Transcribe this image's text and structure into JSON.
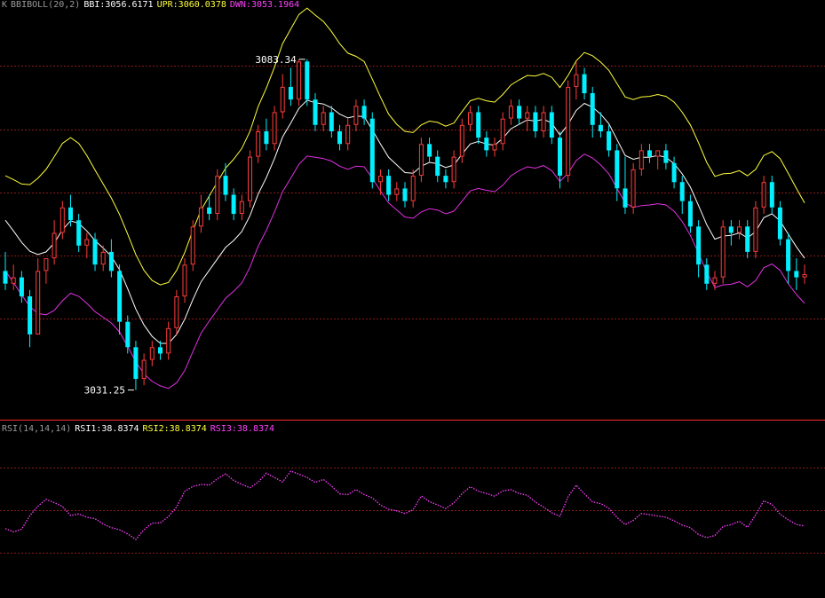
{
  "header": {
    "main": {
      "k_label": "K",
      "indicator": "BBIBOLL(20,2)",
      "bbi": "BBI:3056.6171",
      "upr": "UPR:3060.0378",
      "dwn": "DWN:3053.1964"
    },
    "rsi": {
      "indicator": "RSI(14,14,14)",
      "rsi1": "RSI1:38.8374",
      "rsi2": "RSI2:38.8374",
      "rsi3": "RSI3:38.8374"
    }
  },
  "colors": {
    "background": "#000000",
    "grid": "#8a1a1a",
    "up": "#ff3c3c",
    "down": "#00f0ff",
    "bbi": "#ffffff",
    "upr": "#ffff3a",
    "dwn": "#e030e0",
    "rsi": "#ff40ff",
    "separator": "#ff2a2a"
  },
  "chart_data": [
    {
      "type": "candlestick",
      "name": "main",
      "ylim": [
        3027.0,
        3091.0
      ],
      "gridlines": [
        3082.3,
        3072.3,
        3062.4,
        3052.5,
        3042.5
      ],
      "annotations": [
        {
          "label": "3083.34",
          "index": 37,
          "value": 3083.34,
          "side": "left"
        },
        {
          "label": "3031.25",
          "index": 16,
          "value": 3031.25,
          "side": "left"
        }
      ],
      "ohlc": [
        [
          3050.0,
          3053.0,
          3047.0,
          3048.0
        ],
        [
          3048.0,
          3051.0,
          3047.0,
          3049.0
        ],
        [
          3049.0,
          3050.0,
          3045.0,
          3046.0
        ],
        [
          3046.0,
          3047.0,
          3038.0,
          3040.0
        ],
        [
          3040.0,
          3052.0,
          3040.0,
          3050.0
        ],
        [
          3050.0,
          3052.0,
          3048.0,
          3052.0
        ],
        [
          3052.0,
          3058.0,
          3051.0,
          3056.0
        ],
        [
          3056.0,
          3061.0,
          3055.0,
          3060.0
        ],
        [
          3060.0,
          3062.0,
          3057.0,
          3058.0
        ],
        [
          3058.0,
          3059.0,
          3053.0,
          3054.0
        ],
        [
          3054.0,
          3056.0,
          3052.0,
          3055.0
        ],
        [
          3055.0,
          3056.0,
          3050.0,
          3051.0
        ],
        [
          3051.0,
          3054.0,
          3050.0,
          3053.0
        ],
        [
          3053.0,
          3055.0,
          3049.0,
          3050.0
        ],
        [
          3050.0,
          3051.0,
          3040.0,
          3042.0
        ],
        [
          3042.0,
          3043.0,
          3037.0,
          3038.0
        ],
        [
          3038.0,
          3039.0,
          3031.25,
          3033.0
        ],
        [
          3033.0,
          3037.0,
          3032.0,
          3036.0
        ],
        [
          3036.0,
          3039.0,
          3035.0,
          3038.0
        ],
        [
          3038.0,
          3039.0,
          3036.0,
          3037.0
        ],
        [
          3037.0,
          3042.0,
          3036.0,
          3041.0
        ],
        [
          3041.0,
          3047.0,
          3040.0,
          3046.0
        ],
        [
          3046.0,
          3052.0,
          3045.0,
          3051.0
        ],
        [
          3051.0,
          3058.0,
          3050.0,
          3057.0
        ],
        [
          3057.0,
          3062.0,
          3056.0,
          3060.0
        ],
        [
          3060.0,
          3062.0,
          3058.0,
          3059.0
        ],
        [
          3059.0,
          3066.0,
          3058.0,
          3065.0
        ],
        [
          3065.0,
          3067.0,
          3061.0,
          3062.0
        ],
        [
          3062.0,
          3063.0,
          3058.0,
          3059.0
        ],
        [
          3059.0,
          3062.0,
          3058.0,
          3061.0
        ],
        [
          3061.0,
          3069.0,
          3060.0,
          3068.0
        ],
        [
          3068.0,
          3073.0,
          3067.0,
          3072.0
        ],
        [
          3072.0,
          3074.0,
          3069.0,
          3070.0
        ],
        [
          3070.0,
          3076.0,
          3069.0,
          3075.0
        ],
        [
          3075.0,
          3081.0,
          3074.0,
          3079.0
        ],
        [
          3079.0,
          3082.0,
          3076.0,
          3077.0
        ],
        [
          3077.0,
          3083.34,
          3076.0,
          3083.0
        ],
        [
          3083.0,
          3083.34,
          3076.0,
          3077.0
        ],
        [
          3077.0,
          3078.0,
          3072.0,
          3073.0
        ],
        [
          3073.0,
          3076.0,
          3072.0,
          3075.0
        ],
        [
          3075.0,
          3076.0,
          3071.0,
          3072.0
        ],
        [
          3072.0,
          3073.0,
          3069.0,
          3070.0
        ],
        [
          3070.0,
          3074.0,
          3069.0,
          3073.0
        ],
        [
          3073.0,
          3077.0,
          3072.0,
          3076.0
        ],
        [
          3076.0,
          3077.0,
          3073.0,
          3074.0
        ],
        [
          3074.0,
          3075.0,
          3063.0,
          3064.0
        ],
        [
          3064.0,
          3066.0,
          3062.0,
          3065.0
        ],
        [
          3065.0,
          3066.0,
          3061.0,
          3062.0
        ],
        [
          3062.0,
          3064.0,
          3061.0,
          3063.0
        ],
        [
          3063.0,
          3064.0,
          3060.0,
          3061.0
        ],
        [
          3061.0,
          3066.0,
          3060.0,
          3065.0
        ],
        [
          3065.0,
          3071.0,
          3064.0,
          3070.0
        ],
        [
          3070.0,
          3071.0,
          3067.0,
          3068.0
        ],
        [
          3068.0,
          3069.0,
          3064.0,
          3065.0
        ],
        [
          3065.0,
          3066.0,
          3063.0,
          3064.0
        ],
        [
          3064.0,
          3069.0,
          3063.0,
          3068.0
        ],
        [
          3068.0,
          3074.0,
          3067.0,
          3073.0
        ],
        [
          3073.0,
          3076.0,
          3072.0,
          3075.0
        ],
        [
          3075.0,
          3076.0,
          3070.0,
          3071.0
        ],
        [
          3071.0,
          3072.0,
          3068.0,
          3069.0
        ],
        [
          3069.0,
          3071.0,
          3068.0,
          3070.0
        ],
        [
          3070.0,
          3075.0,
          3069.0,
          3074.0
        ],
        [
          3074.0,
          3077.0,
          3073.0,
          3076.0
        ],
        [
          3076.0,
          3077.0,
          3073.0,
          3074.0
        ],
        [
          3074.0,
          3076.0,
          3072.0,
          3075.0
        ],
        [
          3075.0,
          3076.0,
          3071.0,
          3072.0
        ],
        [
          3072.0,
          3076.0,
          3071.0,
          3075.0
        ],
        [
          3075.0,
          3076.0,
          3070.0,
          3071.0
        ],
        [
          3071.0,
          3072.0,
          3063.0,
          3065.0
        ],
        [
          3065.0,
          3080.0,
          3064.0,
          3079.0
        ],
        [
          3079.0,
          3083.0,
          3077.0,
          3081.0
        ],
        [
          3081.0,
          3082.0,
          3077.0,
          3078.0
        ],
        [
          3078.0,
          3079.0,
          3071.0,
          3073.0
        ],
        [
          3073.0,
          3075.0,
          3071.0,
          3072.0
        ],
        [
          3072.0,
          3073.0,
          3068.0,
          3069.0
        ],
        [
          3069.0,
          3070.0,
          3061.0,
          3063.0
        ],
        [
          3063.0,
          3068.0,
          3059.0,
          3060.0
        ],
        [
          3060.0,
          3067.0,
          3059.0,
          3066.0
        ],
        [
          3066.0,
          3070.0,
          3065.0,
          3069.0
        ],
        [
          3069.0,
          3070.0,
          3067.0,
          3068.0
        ],
        [
          3068.0,
          3069.0,
          3066.0,
          3069.0
        ],
        [
          3069.0,
          3070.0,
          3066.0,
          3067.0
        ],
        [
          3067.0,
          3068.0,
          3063.0,
          3064.0
        ],
        [
          3064.0,
          3065.0,
          3059.0,
          3061.0
        ],
        [
          3061.0,
          3062.0,
          3056.0,
          3057.0
        ],
        [
          3057.0,
          3058.0,
          3049.0,
          3051.0
        ],
        [
          3051.0,
          3052.0,
          3047.0,
          3048.0
        ],
        [
          3048.0,
          3050.0,
          3047.0,
          3049.0
        ],
        [
          3049.0,
          3058.0,
          3048.0,
          3057.0
        ],
        [
          3057.0,
          3058.0,
          3054.0,
          3056.0
        ],
        [
          3056.0,
          3058.0,
          3055.0,
          3057.0
        ],
        [
          3057.0,
          3058.0,
          3052.0,
          3053.0
        ],
        [
          3053.0,
          3061.0,
          3052.0,
          3060.0
        ],
        [
          3060.0,
          3065.0,
          3059.0,
          3064.0
        ],
        [
          3064.0,
          3065.0,
          3059.0,
          3060.0
        ],
        [
          3060.0,
          3061.0,
          3054.0,
          3055.0
        ],
        [
          3055.0,
          3056.0,
          3048.0,
          3050.0
        ],
        [
          3050.0,
          3052.0,
          3047.0,
          3049.0
        ],
        [
          3049.0,
          3051.0,
          3048.0,
          3049.5
        ]
      ],
      "series": [
        {
          "name": "BBI",
          "values": [
            3058.0,
            3056.3,
            3054.5,
            3053.1,
            3052.6,
            3053.0,
            3054.4,
            3056.5,
            3057.9,
            3057.5,
            3056.3,
            3054.8,
            3053.6,
            3052.3,
            3050.2,
            3047.2,
            3044.0,
            3041.5,
            3039.7,
            3038.6,
            3038.6,
            3040.0,
            3042.4,
            3045.5,
            3048.3,
            3050.1,
            3051.9,
            3053.7,
            3054.8,
            3056.2,
            3058.7,
            3062.1,
            3064.7,
            3067.7,
            3071.1,
            3073.3,
            3075.6,
            3076.9,
            3076.5,
            3076.3,
            3075.7,
            3074.7,
            3074.1,
            3074.4,
            3074.3,
            3072.2,
            3070.0,
            3067.9,
            3066.7,
            3065.5,
            3065.4,
            3066.5,
            3067.1,
            3066.9,
            3066.3,
            3066.7,
            3068.4,
            3070.0,
            3070.4,
            3070.0,
            3069.8,
            3070.9,
            3072.4,
            3073.1,
            3073.8,
            3073.6,
            3073.9,
            3073.3,
            3071.4,
            3073.1,
            3075.3,
            3076.4,
            3075.8,
            3074.7,
            3073.2,
            3070.7,
            3068.2,
            3067.6,
            3067.9,
            3067.9,
            3068.2,
            3067.9,
            3066.9,
            3065.3,
            3063.2,
            3060.3,
            3057.3,
            3055.0,
            3055.5,
            3055.6,
            3056.0,
            3055.2,
            3056.2,
            3058.4,
            3059.0,
            3057.9,
            3055.8,
            3053.8,
            3052.0
          ]
        },
        {
          "name": "UPR",
          "values": [
            3065.0,
            3064.4,
            3063.7,
            3063.6,
            3064.6,
            3066.0,
            3068.0,
            3070.1,
            3071.0,
            3070.1,
            3068.2,
            3065.9,
            3063.7,
            3061.5,
            3058.9,
            3055.8,
            3052.6,
            3050.1,
            3048.5,
            3047.8,
            3048.2,
            3050.1,
            3052.9,
            3056.4,
            3059.6,
            3061.8,
            3064.0,
            3066.2,
            3067.6,
            3069.3,
            3072.0,
            3075.9,
            3078.8,
            3082.1,
            3085.8,
            3088.1,
            3090.4,
            3091.4,
            3090.3,
            3089.3,
            3087.7,
            3085.8,
            3084.3,
            3083.8,
            3083.0,
            3080.2,
            3077.4,
            3074.7,
            3073.1,
            3072.0,
            3071.8,
            3073.0,
            3073.6,
            3073.4,
            3072.8,
            3073.3,
            3075.1,
            3076.8,
            3077.2,
            3076.8,
            3076.6,
            3077.8,
            3079.3,
            3080.1,
            3080.8,
            3080.7,
            3081.1,
            3080.5,
            3078.9,
            3080.8,
            3083.1,
            3084.4,
            3083.9,
            3082.9,
            3081.6,
            3079.5,
            3077.4,
            3077.0,
            3077.4,
            3077.5,
            3077.8,
            3077.5,
            3076.6,
            3075.0,
            3073.0,
            3070.2,
            3067.1,
            3064.9,
            3065.3,
            3065.4,
            3065.8,
            3065.0,
            3066.0,
            3068.2,
            3068.8,
            3067.7,
            3065.4,
            3063.0,
            3060.7
          ]
        },
        {
          "name": "DWN",
          "values": [
            3050.0,
            3048.2,
            3046.2,
            3044.4,
            3043.3,
            3043.1,
            3043.8,
            3045.3,
            3046.5,
            3046.0,
            3044.9,
            3043.6,
            3042.7,
            3041.8,
            3040.4,
            3038.1,
            3035.7,
            3033.8,
            3032.6,
            3031.9,
            3031.5,
            3032.4,
            3034.3,
            3037.3,
            3040.2,
            3042.1,
            3043.9,
            3045.7,
            3046.8,
            3048.1,
            3050.6,
            3053.9,
            3056.4,
            3059.3,
            3062.5,
            3064.6,
            3066.8,
            3068.1,
            3067.9,
            3067.7,
            3067.3,
            3066.5,
            3066.0,
            3066.5,
            3066.4,
            3064.6,
            3062.6,
            3060.7,
            3059.6,
            3058.5,
            3058.3,
            3059.3,
            3059.8,
            3059.6,
            3059.0,
            3059.4,
            3061.0,
            3062.6,
            3063.0,
            3062.7,
            3062.5,
            3063.5,
            3065.0,
            3065.8,
            3066.4,
            3066.2,
            3066.6,
            3065.8,
            3064.1,
            3065.4,
            3067.4,
            3068.4,
            3067.8,
            3066.7,
            3065.3,
            3063.0,
            3060.7,
            3060.0,
            3060.3,
            3060.4,
            3060.6,
            3060.4,
            3059.4,
            3057.8,
            3055.6,
            3052.8,
            3049.8,
            3047.4,
            3047.8,
            3047.9,
            3048.3,
            3047.5,
            3048.5,
            3050.5,
            3051.1,
            3050.1,
            3048.0,
            3046.3,
            3044.9
          ]
        }
      ]
    },
    {
      "type": "line",
      "name": "RSI",
      "ylim": [
        0,
        100
      ],
      "gridlines": [
        80,
        50,
        20
      ],
      "series": [
        {
          "name": "RSI",
          "values": [
            37.0,
            34.7,
            36.6,
            46.1,
            52.8,
            57.6,
            55.3,
            52.6,
            46.3,
            47.3,
            45.0,
            44.0,
            40.2,
            37.7,
            36.2,
            33.3,
            29.4,
            36.2,
            40.9,
            41.0,
            45.5,
            52.3,
            63.3,
            66.7,
            68.1,
            67.7,
            72.1,
            75.6,
            71.0,
            68.1,
            65.8,
            69.7,
            76.1,
            73.0,
            69.9,
            77.5,
            75.4,
            73.0,
            69.5,
            71.6,
            67.0,
            61.5,
            61.0,
            64.5,
            61.0,
            58.6,
            53.6,
            50.6,
            49.5,
            47.6,
            50.3,
            60.0,
            56.0,
            53.7,
            51.2,
            55.1,
            61.6,
            66.5,
            63.4,
            61.7,
            59.9,
            63.5,
            64.5,
            61.7,
            60.5,
            55.6,
            52.2,
            48.2,
            45.7,
            59.4,
            67.6,
            61.5,
            55.8,
            54.6,
            51.3,
            44.9,
            39.8,
            42.8,
            47.6,
            46.9,
            45.9,
            45.0,
            42.5,
            39.5,
            37.6,
            32.9,
            30.7,
            32.1,
            38.5,
            39.8,
            42.1,
            37.9,
            46.6,
            56.6,
            54.0,
            47.2,
            43.2,
            39.9,
            38.8
          ]
        }
      ]
    }
  ]
}
